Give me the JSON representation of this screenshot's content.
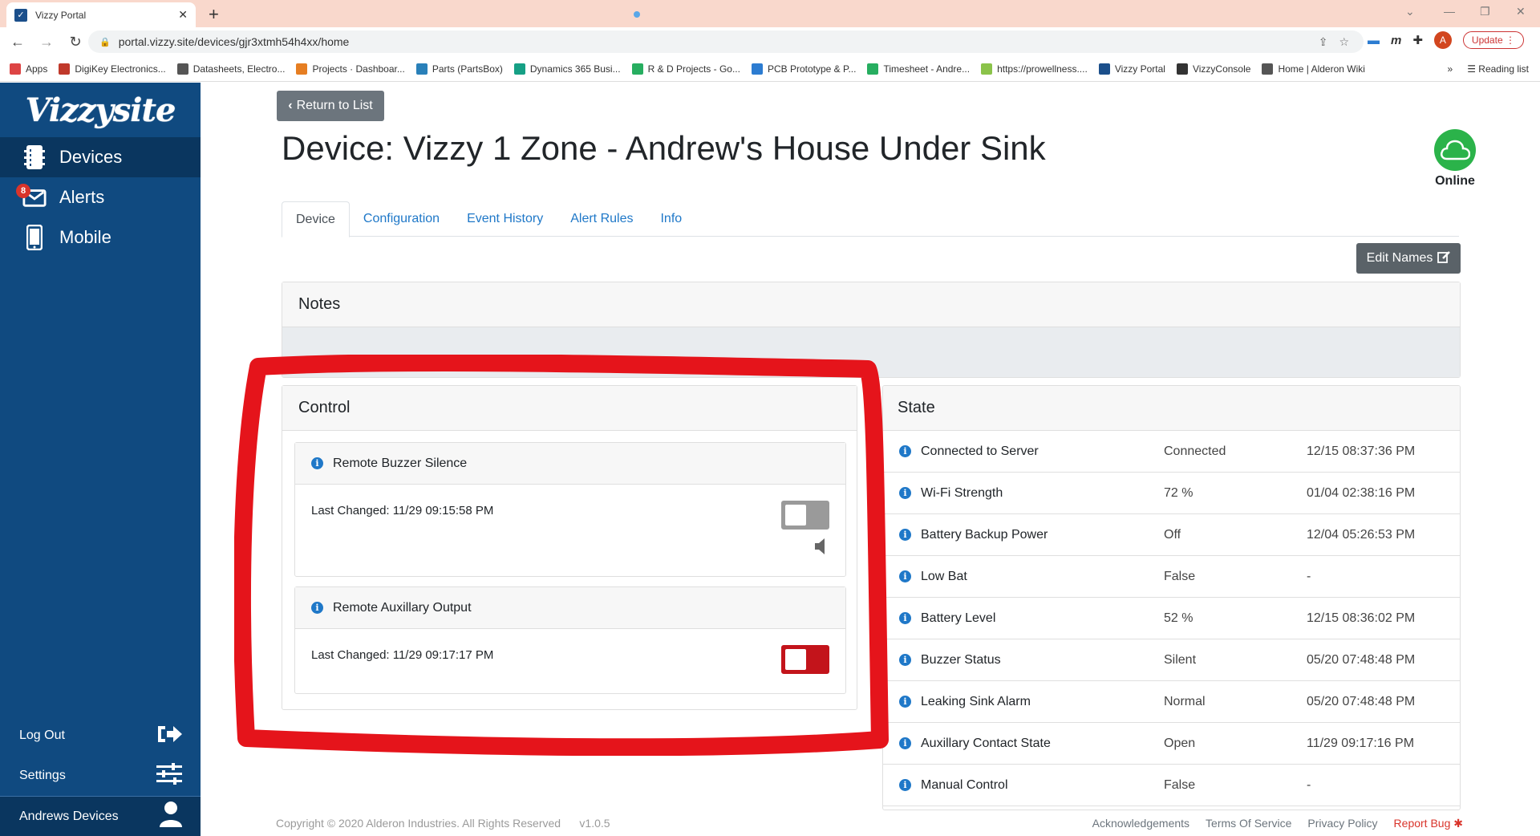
{
  "browser": {
    "tab_title": "Vizzy Portal",
    "url": "portal.vizzy.site/devices/gjr3xtmh54h4xx/home",
    "update_label": "Update",
    "avatar_letter": "A",
    "bookmarks": [
      {
        "label": "Apps",
        "color": "#d44"
      },
      {
        "label": "DigiKey Electronics...",
        "color": "#c0392b"
      },
      {
        "label": "Datasheets, Electro...",
        "color": "#555"
      },
      {
        "label": "Projects · Dashboar...",
        "color": "#e67e22"
      },
      {
        "label": "Parts (PartsBox)",
        "color": "#2980b9"
      },
      {
        "label": "Dynamics 365 Busi...",
        "color": "#16a085"
      },
      {
        "label": "R & D Projects - Go...",
        "color": "#27ae60"
      },
      {
        "label": "PCB Prototype & P...",
        "color": "#2c7cd1"
      },
      {
        "label": "Timesheet - Andre...",
        "color": "#27ae60"
      },
      {
        "label": "https://prowellness....",
        "color": "#8bc34a"
      },
      {
        "label": "Vizzy Portal",
        "color": "#1b4f8b"
      },
      {
        "label": "VizzyConsole",
        "color": "#333"
      },
      {
        "label": "Home | Alderon Wiki",
        "color": "#555"
      }
    ],
    "reading_list": "Reading list",
    "more_bookmarks": "»"
  },
  "sidebar": {
    "logo": "Vizzysite",
    "items": [
      {
        "label": "Devices",
        "icon": "devices-icon"
      },
      {
        "label": "Alerts",
        "icon": "alerts-envelope-icon",
        "badge": "8"
      },
      {
        "label": "Mobile",
        "icon": "mobile-phone-icon"
      }
    ],
    "bottom": {
      "logout": "Log Out",
      "settings": "Settings",
      "user": "Andrews Devices"
    }
  },
  "main": {
    "return_label": "Return to List",
    "title": "Device: Vizzy 1 Zone - Andrew's House Under Sink",
    "status": "Online",
    "tabs": [
      "Device",
      "Configuration",
      "Event History",
      "Alert Rules",
      "Info"
    ],
    "edit_names_label": "Edit Names",
    "notes_title": "Notes",
    "control": {
      "title": "Control",
      "items": [
        {
          "name": "Remote Buzzer Silence",
          "last_changed": "Last Changed: 11/29 09:15:58 PM",
          "state": "off"
        },
        {
          "name": "Remote Auxillary Output",
          "last_changed": "Last Changed: 11/29 09:17:17 PM",
          "state": "on"
        }
      ]
    },
    "state": {
      "title": "State",
      "rows": [
        {
          "name": "Connected to Server",
          "value": "Connected",
          "time": "12/15 08:37:36 PM"
        },
        {
          "name": "Wi-Fi Strength",
          "value": "72 %",
          "time": "01/04 02:38:16 PM"
        },
        {
          "name": "Battery Backup Power",
          "value": "Off",
          "time": "12/04 05:26:53 PM"
        },
        {
          "name": "Low Bat",
          "value": "False",
          "time": "-"
        },
        {
          "name": "Battery Level",
          "value": "52 %",
          "time": "12/15 08:36:02 PM"
        },
        {
          "name": "Buzzer Status",
          "value": "Silent",
          "time": "05/20 07:48:48 PM"
        },
        {
          "name": "Leaking Sink Alarm",
          "value": "Normal",
          "time": "05/20 07:48:48 PM"
        },
        {
          "name": "Auxillary Contact State",
          "value": "Open",
          "time": "11/29 09:17:16 PM"
        },
        {
          "name": "Manual Control",
          "value": "False",
          "time": "-"
        }
      ]
    }
  },
  "footer": {
    "copyright": "Copyright © 2020 Alderon Industries. All Rights Reserved",
    "version": "v1.0.5",
    "links": [
      "Acknowledgements",
      "Terms Of Service",
      "Privacy Policy",
      "Report Bug"
    ]
  },
  "colors": {
    "sidebar": "#104a80",
    "accent_link": "#1f78c8",
    "online_green": "#2bb34a",
    "toggle_on": "#c3141b",
    "annotation_red": "#e5141b"
  }
}
